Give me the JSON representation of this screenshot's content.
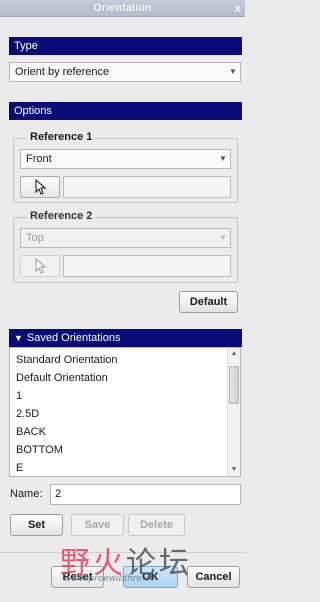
{
  "window": {
    "title": "Orientation",
    "close_glyph": "x"
  },
  "type_section": {
    "header": "Type",
    "dropdown_value": "Orient by reference"
  },
  "options_section": {
    "header": "Options",
    "reference1": {
      "legend": "Reference 1",
      "dropdown_value": "Front",
      "picker_icon": "arrow-cursor-icon"
    },
    "reference2": {
      "legend": "Reference 2",
      "dropdown_value": "Top",
      "picker_icon": "arrow-cursor-icon"
    },
    "default_button": "Default"
  },
  "saved_section": {
    "header": "Saved Orientations",
    "items": [
      "Standard Orientation",
      "Default Orientation",
      "1",
      "2.5D",
      "BACK",
      "BOTTOM",
      "E"
    ],
    "name_label": "Name:",
    "name_value": "2",
    "set_button": "Set",
    "save_button": "Save",
    "delete_button": "Delete"
  },
  "footer": {
    "reset_button": "Reset",
    "ok_button": "OK",
    "cancel_button": "Cancel"
  },
  "watermark": {
    "text_part1": "野火",
    "text_part2": "论坛",
    "url": "www.proewildfire.cn"
  }
}
